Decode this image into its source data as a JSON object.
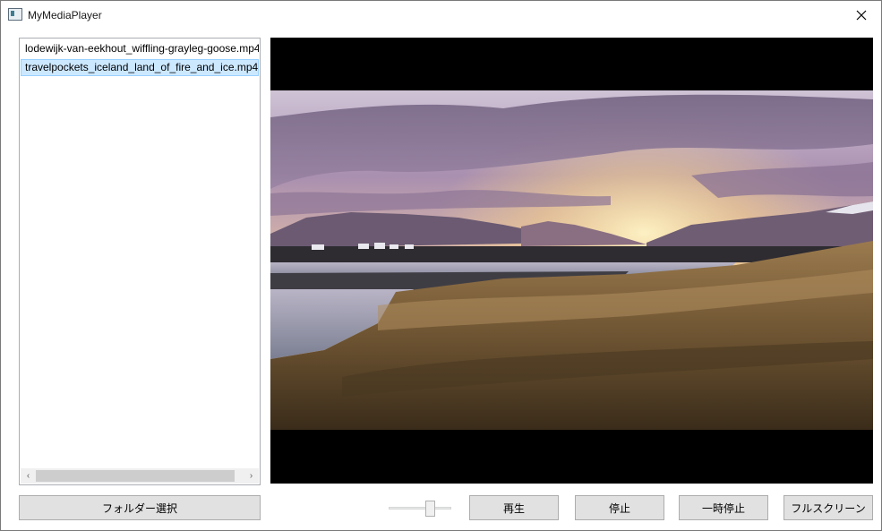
{
  "window": {
    "title": "MyMediaPlayer"
  },
  "file_list": {
    "items": [
      {
        "label": "lodewijk-van-eekhout_wiffling-grayleg-goose.mp4",
        "selected": false
      },
      {
        "label": "travelpockets_iceland_land_of_fire_and_ice.mp4",
        "selected": true
      }
    ],
    "scroll_left_glyph": "‹",
    "scroll_right_glyph": "›"
  },
  "controls": {
    "folder_button_label": "フォルダー選択",
    "play_label": "再生",
    "stop_label": "停止",
    "pause_label": "一時停止",
    "fullscreen_label": "フルスクリーン",
    "volume_level": 0.7
  },
  "icons": {
    "app": "app-window-icon",
    "close": "close-icon"
  },
  "colors": {
    "selection_bg": "#cce8ff",
    "selection_border": "#99d1ff",
    "button_bg": "#e1e1e1",
    "video_letterbox": "#000000"
  }
}
